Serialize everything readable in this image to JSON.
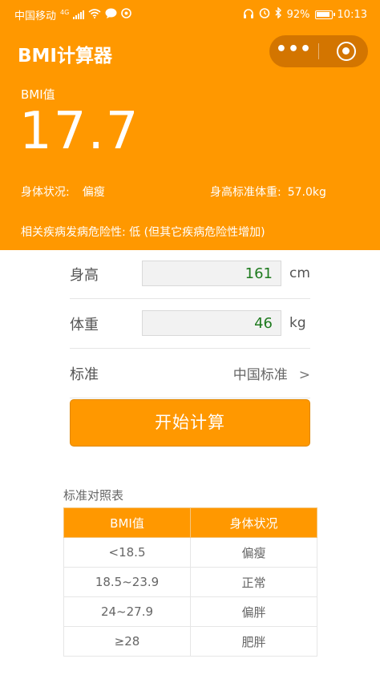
{
  "status_bar": {
    "carrier": "中国移动",
    "network": "4G",
    "battery": "92%",
    "time": "10:13",
    "icons_left": [
      "signal-icon",
      "wifi-icon",
      "chat-icon",
      "message-icon"
    ],
    "icons_right": [
      "headphones-icon",
      "alarm-icon",
      "bluetooth-icon",
      "battery-icon"
    ]
  },
  "app": {
    "title": "BMI计算器",
    "capsule_more": "•••"
  },
  "result": {
    "bmi_label": "BMI值",
    "bmi_value": "17.7",
    "body_status_label": "身体状况:",
    "body_status_value": "偏瘦",
    "std_weight_label": "身高标准体重:",
    "std_weight_value": "57.0kg",
    "risk_text": "相关疾病发病危险性: 低 (但其它疾病危险性增加)"
  },
  "form": {
    "height_label": "身高",
    "height_value": "161",
    "height_unit": "cm",
    "weight_label": "体重",
    "weight_value": "46",
    "weight_unit": "kg",
    "standard_label": "标准",
    "standard_value": "中国标准",
    "standard_chevron": ">"
  },
  "button": {
    "calculate": "开始计算"
  },
  "reference": {
    "title": "标准对照表",
    "headers": [
      "BMI值",
      "身体状况"
    ],
    "rows": [
      [
        "<18.5",
        "偏瘦"
      ],
      [
        "18.5~23.9",
        "正常"
      ],
      [
        "24~27.9",
        "偏胖"
      ],
      [
        "≥28",
        "肥胖"
      ]
    ]
  },
  "colors": {
    "accent": "#FF9800",
    "input_text": "#1e7a1e"
  }
}
